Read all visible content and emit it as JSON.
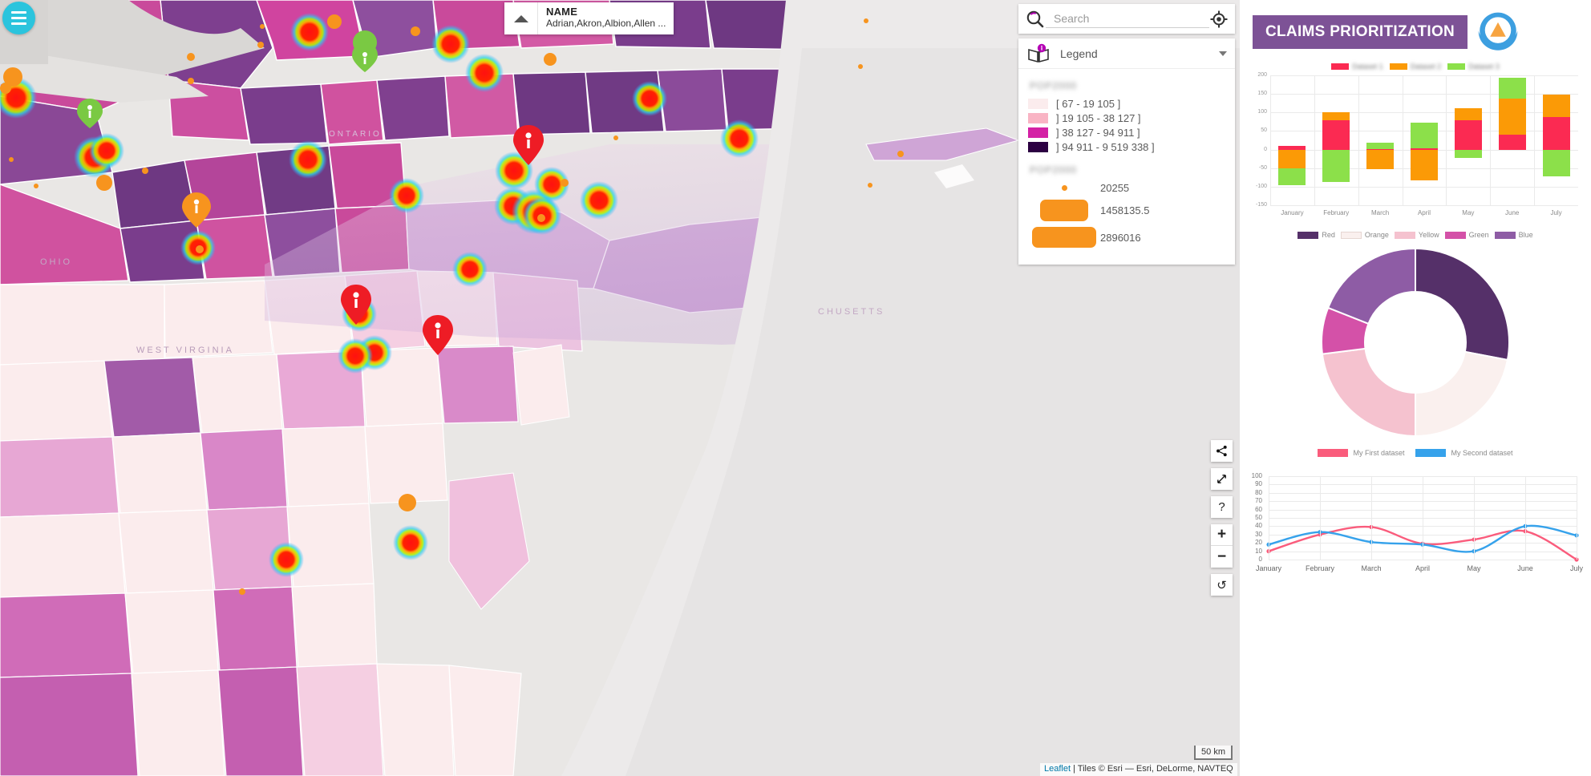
{
  "app": {
    "title": "CLAIMS PRIORITIZATION",
    "logo_icon": "triangle-in-circle-logo",
    "menu_icon": "hamburger-menu-icon"
  },
  "map": {
    "popup": {
      "title": "NAME",
      "subtitle": "Adrian,Akron,Albion,Allen ...",
      "collapse_icon": "triangle-up-icon"
    },
    "search": {
      "placeholder": "Search",
      "value": "",
      "search_icon": "search-icon",
      "locate_icon": "crosshair-locate-icon"
    },
    "legend": {
      "title": "Legend",
      "legend_icon": "legend-book-info-icon",
      "collapse_icon": "chevron-down-icon",
      "choropleth": {
        "field_label": "POP2000",
        "items": [
          {
            "range": "[ 67 - 19 105 ]",
            "color": "#fbeced"
          },
          {
            "range": "] 19 105 - 38 127 ]",
            "color": "#f9b4c4"
          },
          {
            "range": "] 38 127 - 94 911 ]",
            "color": "#d421a5"
          },
          {
            "range": "] 94 911 - 9 519 338 ]",
            "color": "#2c0042"
          }
        ]
      },
      "proportional": {
        "field_label": "POP2000",
        "color": "#f7941e",
        "items": [
          {
            "value": "20255",
            "w": 7,
            "h": 7
          },
          {
            "value": "1458135.5",
            "w": 60,
            "h": 27
          },
          {
            "value": "2896016",
            "w": 80,
            "h": 26
          }
        ]
      }
    },
    "controls": [
      {
        "name": "share-button",
        "icon": "share-icon",
        "glyph": "‹"
      },
      {
        "name": "fullscreen-button",
        "icon": "expand-arrows-icon",
        "glyph": "⤢"
      },
      {
        "name": "help-button",
        "icon": "question-mark-icon",
        "glyph": "?"
      },
      {
        "name": "zoom-in-button",
        "icon": "plus-icon",
        "glyph": "+"
      },
      {
        "name": "zoom-out-button",
        "icon": "minus-icon",
        "glyph": "−"
      },
      {
        "name": "reset-view-button",
        "icon": "reset-rotate-icon",
        "glyph": "↺"
      }
    ],
    "scale": "50 km",
    "attribution_link": "Leaflet",
    "attribution_text": " | Tiles © Esri — Esri, DeLorme, NAVTEQ"
  },
  "chart_data": [
    {
      "type": "bar",
      "id": "stacked-bar-chart",
      "stacked": true,
      "title": "",
      "xlabel": "",
      "ylabel": "",
      "categories": [
        "January",
        "February",
        "March",
        "April",
        "May",
        "June",
        "July"
      ],
      "ylim": [
        -150,
        200
      ],
      "yticks": [
        200,
        150,
        100,
        50,
        0,
        -50,
        -100,
        -150
      ],
      "grid": true,
      "legend_position": "top",
      "series": [
        {
          "name": "Dataset 1",
          "color": "#fb2a52",
          "values": [
            10,
            78,
            2,
            4,
            80,
            40,
            88
          ]
        },
        {
          "name": "Dataset 2",
          "color": "#fb9a06",
          "values": [
            -50,
            22,
            -52,
            -82,
            32,
            97,
            60
          ]
        },
        {
          "name": "Dataset 3",
          "color": "#8ce04a",
          "values": [
            -45,
            -88,
            16,
            68,
            -22,
            57,
            -72
          ]
        }
      ]
    },
    {
      "type": "pie",
      "id": "donut-chart",
      "doughnut": true,
      "title": "",
      "labels": [
        "Red",
        "Orange",
        "Yellow",
        "Green",
        "Blue"
      ],
      "values": [
        28,
        22,
        23,
        8,
        19
      ],
      "colors": [
        "#553069",
        "#faf0ee",
        "#f5c2cf",
        "#d451a8",
        "#8e5ca5"
      ],
      "legend_position": "top"
    },
    {
      "type": "line",
      "id": "line-chart",
      "title": "",
      "xlabel": "",
      "ylabel": "",
      "categories": [
        "January",
        "February",
        "March",
        "April",
        "May",
        "June",
        "July"
      ],
      "ylim": [
        0,
        100
      ],
      "yticks": [
        0,
        10,
        20,
        30,
        40,
        50,
        60,
        70,
        80,
        90,
        100
      ],
      "grid": true,
      "legend_position": "top",
      "series": [
        {
          "name": "My First dataset",
          "color": "#fa5c7c",
          "values": [
            10,
            30,
            39,
            19,
            24,
            34,
            0
          ]
        },
        {
          "name": "My Second dataset",
          "color": "#36a2eb",
          "values": [
            18,
            33,
            21,
            18,
            10,
            40,
            29
          ]
        }
      ]
    }
  ]
}
